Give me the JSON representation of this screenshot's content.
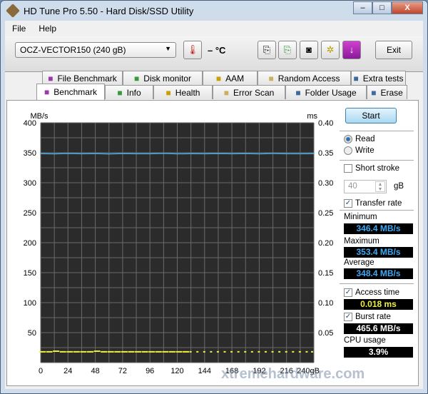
{
  "window": {
    "title": "HD Tune Pro 5.50 - Hard Disk/SSD Utility",
    "min": "–",
    "max": "□",
    "close": "X"
  },
  "menu": {
    "file": "File",
    "help": "Help"
  },
  "toolbar": {
    "drive": "OCZ-VECTOR150 (240 gB)",
    "temperature": "– °C",
    "exit": "Exit"
  },
  "tabs_top": [
    {
      "label": "File Benchmark",
      "icon": "exclamation-page-icon"
    },
    {
      "label": "Disk monitor",
      "icon": "bar-chart-icon"
    },
    {
      "label": "AAM",
      "icon": "speaker-icon"
    },
    {
      "label": "Random Access",
      "icon": "dots-icon"
    },
    {
      "label": "Extra tests",
      "icon": "calculator-icon"
    }
  ],
  "tabs_bottom": [
    {
      "label": "Benchmark",
      "icon": "exclamation-icon",
      "active": true
    },
    {
      "label": "Info",
      "icon": "info-icon"
    },
    {
      "label": "Health",
      "icon": "red-cross-icon"
    },
    {
      "label": "Error Scan",
      "icon": "magnifier-icon"
    },
    {
      "label": "Folder Usage",
      "icon": "folder-icon"
    },
    {
      "label": "Erase",
      "icon": "trash-icon"
    }
  ],
  "side": {
    "start": "Start",
    "read": "Read",
    "write": "Write",
    "read_selected": true,
    "short_stroke": "Short stroke",
    "short_stroke_checked": false,
    "stroke_value": "40",
    "stroke_unit": "gB",
    "transfer_rate": "Transfer rate",
    "minimum_label": "Minimum",
    "minimum": "346.4 MB/s",
    "maximum_label": "Maximum",
    "maximum": "353.4 MB/s",
    "average_label": "Average",
    "average": "348.4 MB/s",
    "access_time": "Access time",
    "access_value": "0.018 ms",
    "burst_rate": "Burst rate",
    "burst_value": "465.6 MB/s",
    "cpu_label": "CPU usage",
    "cpu_value": "3.9%"
  },
  "watermark": "xtremehardware.com",
  "chart_data": {
    "type": "line",
    "ylabel_left": "MB/s",
    "ylabel_right": "ms",
    "ylim_left": [
      0,
      400
    ],
    "ylim_right": [
      0,
      0.4
    ],
    "xlim": [
      0,
      240
    ],
    "yticks_left": [
      "400",
      "350",
      "300",
      "250",
      "200",
      "150",
      "100",
      "50"
    ],
    "yticks_right": [
      "0.40",
      "0.35",
      "0.30",
      "0.25",
      "0.20",
      "0.15",
      "0.10",
      "0.05"
    ],
    "xticks": [
      "0",
      "24",
      "48",
      "72",
      "96",
      "120",
      "144",
      "168",
      "192",
      "216",
      "240gB"
    ],
    "grid": true,
    "colors": {
      "transfer": "#4aa8e0",
      "access": "#f0f040",
      "background": "#2b2b2b",
      "grid": "#6a6a6a"
    },
    "series": [
      {
        "key": "transfer",
        "x": [
          0,
          12,
          24,
          36,
          48,
          60,
          72,
          84,
          96,
          108,
          120,
          132,
          144,
          156,
          168,
          180,
          192,
          204,
          216,
          228,
          240
        ],
        "values": [
          348.5,
          348.2,
          348.8,
          348.3,
          348.6,
          348.1,
          348.7,
          348.4,
          348.3,
          348.9,
          348.2,
          348.5,
          348.4,
          348.7,
          348.3,
          348.6,
          348.2,
          348.8,
          348.4,
          348.3,
          348.5
        ]
      },
      {
        "key": "access",
        "x": [
          0,
          6,
          12,
          18,
          24,
          30,
          36,
          42,
          48,
          54,
          60,
          66,
          72,
          78,
          84,
          90,
          96,
          102,
          108,
          114,
          120,
          126,
          132,
          138,
          144,
          150,
          156,
          162,
          168,
          174,
          180,
          186,
          192,
          198,
          204,
          210,
          216,
          222,
          228,
          234,
          240
        ],
        "values": [
          0.018,
          0.018,
          0.019,
          0.018,
          0.018,
          0.018,
          0.018,
          0.018,
          0.019,
          0.018,
          0.018,
          0.018,
          0.018,
          0.018,
          0.018,
          0.018,
          0.018,
          0.018,
          0.018,
          0.018,
          0.018,
          0.018,
          0.018,
          0.018,
          0.018,
          0.018,
          0.018,
          0.018,
          0.018,
          0.018,
          0.018,
          0.018,
          0.018,
          0.018,
          0.018,
          0.018,
          0.018,
          0.018,
          0.018,
          0.018,
          0.018
        ]
      }
    ]
  }
}
